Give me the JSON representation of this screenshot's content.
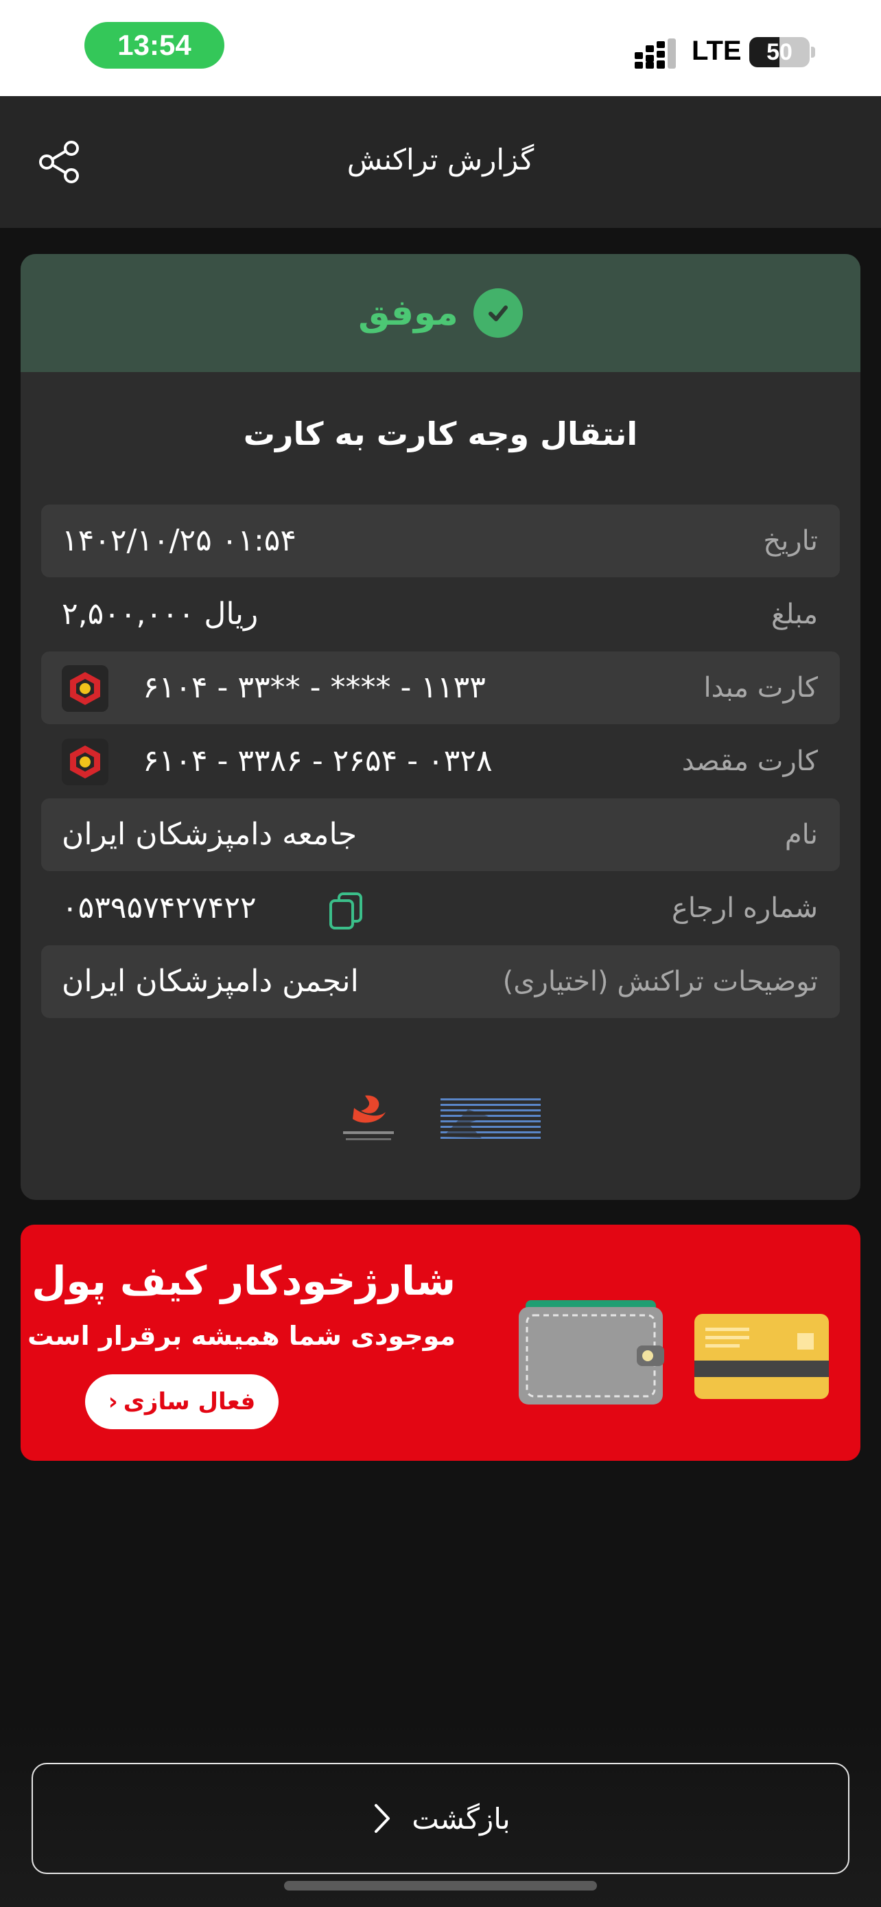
{
  "status_bar": {
    "time": "13:54",
    "network": "LTE",
    "battery": "50",
    "battery_fraction": 0.5
  },
  "header": {
    "title": "گزارش تراکنش",
    "share_icon": "share-icon"
  },
  "status": {
    "label": "موفق",
    "icon": "check-circle-icon",
    "color": "#4cc774"
  },
  "transaction": {
    "title": "انتقال وجه کارت به کارت",
    "rows": [
      {
        "label": "تاریخ",
        "value": "۱۴۰۲/۱۰/۲۵ ۰۱:۵۴"
      },
      {
        "label": "مبلغ",
        "value": "۲,۵۰۰,۰۰۰ ریال"
      },
      {
        "label": "کارت مبدا",
        "value": "۶۱۰۴ - ۳۳** - **** - ۱۱۳۳"
      },
      {
        "label": "کارت مقصد",
        "value": "۶۱۰۴ - ۳۳۸۶ - ۲۶۵۴ - ۰۳۲۸"
      },
      {
        "label": "نام",
        "value": "جامعه دامپزشکان ایران"
      },
      {
        "label": "شماره ارجاع",
        "value": "۰۵۳۹۵۷۴۲۷۴۲۲"
      },
      {
        "label": "توضیحات تراکنش (اختیاری)",
        "value": "انجمن دامپزشکان ایران"
      }
    ]
  },
  "banner": {
    "title": "شارژخودکار کیف پول",
    "subtitle": "موجودی شما همیشه برقرار است",
    "button_label": "فعال سازی",
    "background_color": "#e30613"
  },
  "footer": {
    "back_label": "بازگشت"
  }
}
